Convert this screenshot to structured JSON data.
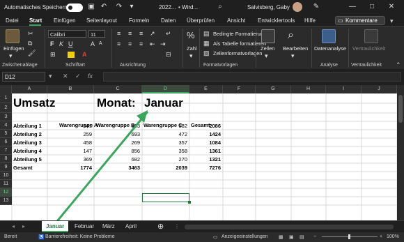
{
  "titlebar": {
    "autosave_label": "Automatisches Speichern",
    "filename": "2022...",
    "app": "• Wird...",
    "user": "Salvisberg, Gaby"
  },
  "menu": [
    "Datei",
    "Start",
    "Einfügen",
    "Seitenlayout",
    "Formeln",
    "Daten",
    "Überprüfen",
    "Ansicht",
    "Entwicklertools",
    "Hilfe"
  ],
  "comment_button": "Kommentare",
  "ribbon": {
    "paste": "Einfügen",
    "font_name": "Calibri",
    "font_size": "11",
    "cond_format": "Bedingte Formatierung",
    "as_table": "Als Tabelle formatieren",
    "cell_styles": "Zellenformatvorlagen",
    "number": "Zahl",
    "cells": "Zellen",
    "editing": "Bearbeiten",
    "data_analysis": "Datenanalyse",
    "confidentiality": "Vertraulichkeit",
    "groups": {
      "clipboard": "Zwischenablage",
      "font": "Schriftart",
      "alignment": "Ausrichtung",
      "styles": "Formatvorlagen",
      "analysis": "Analyse",
      "confidentiality": "Vertraulichkeit"
    }
  },
  "namebox": "D12",
  "fx": "fx",
  "columns": [
    "A",
    "B",
    "C",
    "D",
    "E",
    "F",
    "G",
    "H",
    "I",
    "J"
  ],
  "rows": [
    "1",
    "2",
    "3",
    "4",
    "5",
    "6",
    "7",
    "8",
    "9",
    "10",
    "11",
    "12",
    "13"
  ],
  "sheet": {
    "title": "Umsatz",
    "month_label": "Monat:",
    "month_value": "Januar",
    "headers": [
      "Warengruppe A",
      "Warengruppe B",
      "Warengruppe C",
      "Gesamt"
    ],
    "data": [
      {
        "label": "Abteilung 1",
        "a": "541",
        "b": "963",
        "c": "582",
        "total": "2086"
      },
      {
        "label": "Abteilung 2",
        "a": "259",
        "b": "693",
        "c": "472",
        "total": "1424"
      },
      {
        "label": "Abteilung 3",
        "a": "458",
        "b": "269",
        "c": "357",
        "total": "1084"
      },
      {
        "label": "Abteilung 4",
        "a": "147",
        "b": "856",
        "c": "358",
        "total": "1361"
      },
      {
        "label": "Abteilung 5",
        "a": "369",
        "b": "682",
        "c": "270",
        "total": "1321"
      }
    ],
    "total": {
      "label": "Gesamt",
      "a": "1774",
      "b": "3463",
      "c": "2039",
      "total": "7276"
    }
  },
  "tabs": [
    "Januar",
    "Februar",
    "März",
    "April"
  ],
  "status": {
    "ready": "Bereit",
    "accessibility": "Barrierefreiheit: Keine Probleme",
    "display": "Anzeigeeinstellungen",
    "zoom": "100%"
  },
  "accent": "#3aa55c"
}
